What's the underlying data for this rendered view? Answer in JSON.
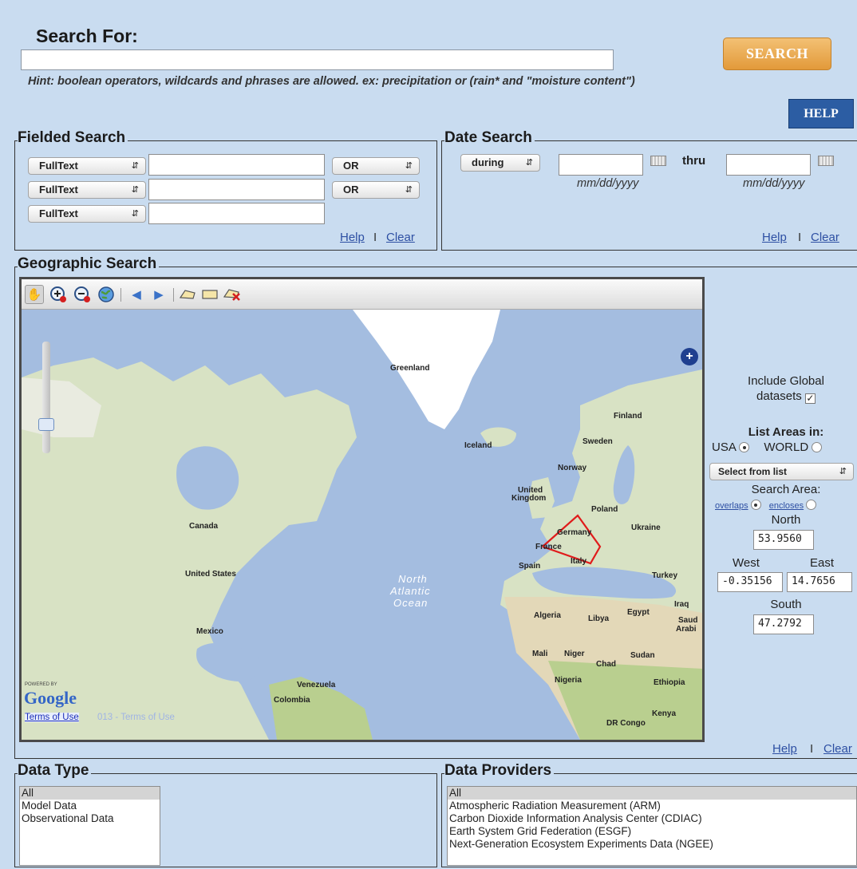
{
  "search": {
    "title": "Search For:",
    "value": "",
    "button": "SEARCH",
    "hint": "Hint: boolean operators, wildcards and phrases are allowed. ex: precipitation or (rain* and \"moisture content\")",
    "help_button": "HELP"
  },
  "fielded": {
    "legend": "Fielded Search",
    "rows": [
      {
        "field": "FullText",
        "value": "",
        "op": "OR"
      },
      {
        "field": "FullText",
        "value": "",
        "op": "OR"
      },
      {
        "field": "FullText",
        "value": ""
      }
    ],
    "help": "Help",
    "sep": "I",
    "clear": "Clear"
  },
  "date": {
    "legend": "Date Search",
    "mode": "during",
    "from_value": "",
    "thru": "thru",
    "to_value": "",
    "format_from": "mm/dd/yyyy",
    "format_to": "mm/dd/yyyy",
    "help": "Help",
    "sep": "I",
    "clear": "Clear"
  },
  "geo": {
    "legend": "Geographic Search",
    "toolbar_icons": [
      "pan-hand-icon",
      "zoom-in-icon",
      "zoom-out-icon",
      "globe-icon",
      "back-arrow-icon",
      "forward-arrow-icon",
      "draw-polygon-icon",
      "draw-rectangle-icon",
      "clear-polygon-icon"
    ],
    "map_labels": {
      "greenland": "Greenland",
      "iceland": "Iceland",
      "finland": "Finland",
      "sweden": "Sweden",
      "norway": "Norway",
      "uk_1": "United",
      "uk_2": "Kingdom",
      "poland": "Poland",
      "germany": "Germany",
      "ukraine": "Ukraine",
      "france": "France",
      "spain": "Spain",
      "italy": "Italy",
      "turkey": "Turkey",
      "iraq": "Iraq",
      "canada": "Canada",
      "us": "United States",
      "ocean_1": "North",
      "ocean_2": "Atlantic",
      "ocean_3": "Ocean",
      "algeria": "Algeria",
      "libya": "Libya",
      "egypt": "Egypt",
      "saudi_1": "Saud",
      "saudi_2": "Arabi",
      "mexico": "Mexico",
      "mali": "Mali",
      "niger": "Niger",
      "chad": "Chad",
      "sudan": "Sudan",
      "nigeria": "Nigeria",
      "ethiopia": "Ethiopia",
      "venezuela": "Venezuela",
      "colombia": "Colombia",
      "kenya": "Kenya",
      "drc": "DR Congo"
    },
    "powered_by": "POWERED BY",
    "google": "Google",
    "terms_1": "Terms of Use",
    "terms_2": "013 - Terms of Use",
    "include_global_1": "Include Global",
    "include_global_2": "datasets",
    "include_global_checked": true,
    "list_areas": "List Areas in:",
    "usa": "USA",
    "world": "WORLD",
    "area_select": "Select from list",
    "search_area": "Search Area:",
    "overlaps": "overlaps",
    "encloses": "encloses",
    "north_label": "North",
    "north": "53.9560",
    "west_label": "West",
    "east_label": "East",
    "west": "-0.35156",
    "east": "14.7656",
    "south_label": "South",
    "south": "47.2792",
    "help": "Help",
    "sep": "I",
    "clear": "Clear"
  },
  "data_type": {
    "legend": "Data Type",
    "options": [
      "All",
      "Model Data",
      "Observational Data"
    ]
  },
  "providers": {
    "legend": "Data Providers",
    "options": [
      "All",
      "Atmospheric Radiation Measurement (ARM)",
      "Carbon Dioxide Information Analysis Center (CDIAC)",
      "Earth System Grid Federation (ESGF)",
      "Next-Generation Ecosystem Experiments Data (NGEE)"
    ]
  },
  "colors": {
    "background": "#c9dcf0",
    "search_button": "#e29a3a",
    "help_button": "#2c5da3",
    "ocean": "#a4bde0",
    "land": "#d8e2c4",
    "polygon": "#e01b1b"
  }
}
